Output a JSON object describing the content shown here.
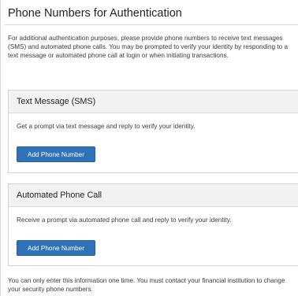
{
  "page": {
    "title": "Phone Numbers for Authentication",
    "intro": "For additional authentication purposes, please provide phone numbers to receive text messages (SMS) and automated phone calls. You may be prompted to verify your identity by responding to a text message or automated phone call at login or when initiating transactions."
  },
  "sms": {
    "title": "Text Message (SMS)",
    "description": "Get a prompt via text message and reply to verify your identity.",
    "button_label": "Add Phone Number"
  },
  "call": {
    "title": "Automated Phone Call",
    "description": "Receive a prompt via automated phone call and reply to verify your identity.",
    "button_label": "Add Phone Number"
  },
  "footer": {
    "note": "You can only enter this information one time. You must contact your financial institution to change your security phone numbers."
  },
  "colors": {
    "button": "#2f72b8",
    "panel_header": "#f2f2f2",
    "border": "#d4d4d4"
  }
}
